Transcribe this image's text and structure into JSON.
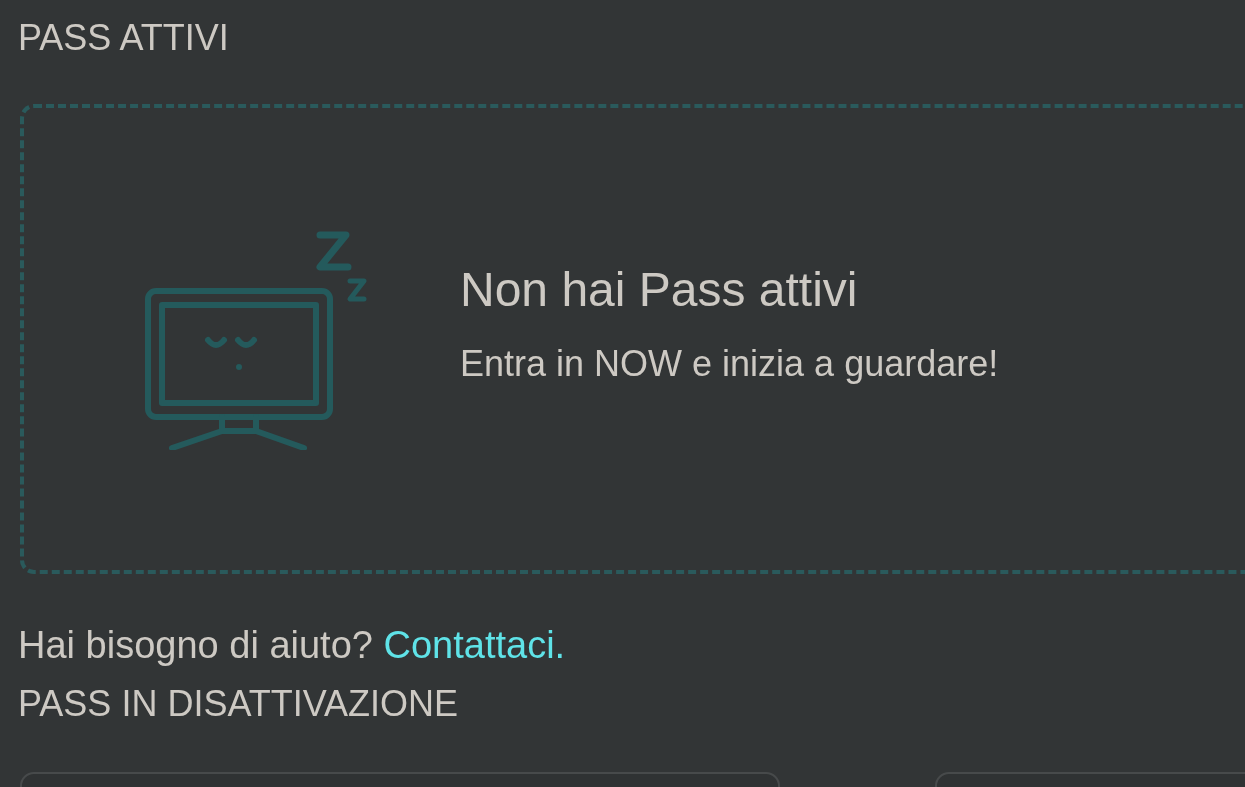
{
  "active_section": {
    "title": "PASS ATTIVI",
    "empty_state": {
      "heading": "Non hai Pass attivi",
      "message": "Entra in NOW e inizia a guardare!"
    }
  },
  "help": {
    "text": "Hai bisogno di aiuto?",
    "link": "Contattaci."
  },
  "deactivating_section": {
    "title": "PASS IN DISATTIVAZIONE",
    "cards": [
      {
        "kind": "card"
      },
      {
        "kind": "card"
      }
    ]
  }
}
